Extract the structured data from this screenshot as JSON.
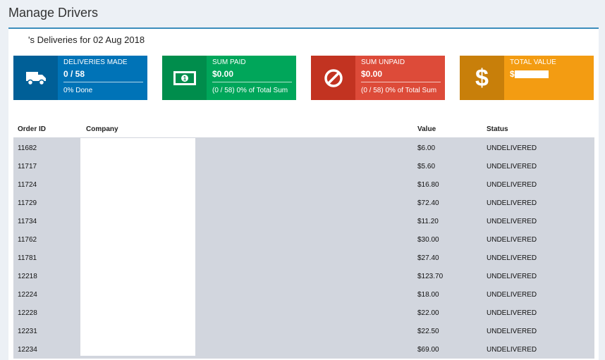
{
  "page": {
    "title": "Manage Drivers"
  },
  "panel": {
    "heading": "'s Deliveries for 02 Aug 2018"
  },
  "stats": {
    "deliveries": {
      "label": "DELIVERIES MADE",
      "value": "0 / 58",
      "desc": "0% Done",
      "icon": "truck-icon"
    },
    "paid": {
      "label": "SUM PAID",
      "value": "$0.00",
      "desc": "(0 / 58) 0% of Total Sum",
      "icon": "money-icon"
    },
    "unpaid": {
      "label": "SUM UNPAID",
      "value": "$0.00",
      "desc": "(0 / 58) 0% of Total Sum",
      "icon": "ban-icon"
    },
    "total": {
      "label": "TOTAL VALUE",
      "value": "$",
      "icon": "dollar-icon"
    }
  },
  "table": {
    "headers": {
      "order_id": "Order ID",
      "company": "Company",
      "value": "Value",
      "status": "Status"
    },
    "rows": [
      {
        "order_id": "11682",
        "value": "$6.00",
        "status": "UNDELIVERED"
      },
      {
        "order_id": "11717",
        "value": "$5.60",
        "status": "UNDELIVERED"
      },
      {
        "order_id": "11724",
        "value": "$16.80",
        "status": "UNDELIVERED"
      },
      {
        "order_id": "11729",
        "value": "$72.40",
        "status": "UNDELIVERED"
      },
      {
        "order_id": "11734",
        "value": "$11.20",
        "status": "UNDELIVERED"
      },
      {
        "order_id": "11762",
        "value": "$30.00",
        "status": "UNDELIVERED"
      },
      {
        "order_id": "11781",
        "value": "$27.40",
        "status": "UNDELIVERED"
      },
      {
        "order_id": "12218",
        "value": "$123.70",
        "status": "UNDELIVERED"
      },
      {
        "order_id": "12224",
        "value": "$18.00",
        "status": "UNDELIVERED"
      },
      {
        "order_id": "12228",
        "value": "$22.00",
        "status": "UNDELIVERED"
      },
      {
        "order_id": "12231",
        "value": "$22.50",
        "status": "UNDELIVERED"
      },
      {
        "order_id": "12234",
        "value": "$69.00",
        "status": "UNDELIVERED"
      }
    ]
  },
  "colors": {
    "blue": "#0073b7",
    "green": "#00a65a",
    "red": "#dd4b39",
    "orange": "#f39c12",
    "accent": "#3c8dbc",
    "row_bg": "#d2d6de"
  }
}
